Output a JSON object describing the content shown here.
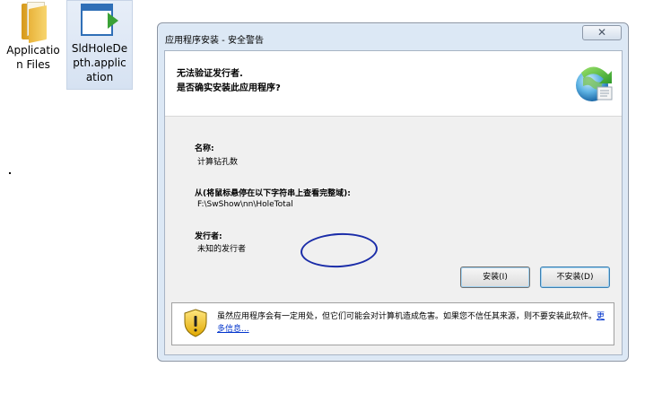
{
  "desktop": {
    "icons": [
      {
        "name": "folder",
        "label_line1": "Applicatio",
        "label_line2": "n Files"
      },
      {
        "name": "application",
        "label_line1": "SldHoleDe",
        "label_line2": "pth.applic",
        "label_line3": "ation"
      }
    ]
  },
  "dialog": {
    "title": "应用程序安装 - 安全警告",
    "close_glyph": "✕",
    "header": {
      "line1": "无法验证发行者.",
      "line2": "是否确实安装此应用程序?"
    },
    "info": {
      "name_label": "名称:",
      "name_value": "计算钻孔数",
      "from_label": "从(将鼠标悬停在以下字符串上查看完整域):",
      "from_value": "F:\\SwShow\\nn\\HoleTotal",
      "publisher_label": "发行者:",
      "publisher_value": "未知的发行者"
    },
    "buttons": {
      "install": "安装(I)",
      "no_install": "不安装(D)"
    },
    "warning": {
      "text": "虽然应用程序会有一定用处，但它们可能会对计算机造成危害。如果您不信任其来源，则不要安装此软件。",
      "link": "更多信息..."
    },
    "colors": {
      "link": "#0033cc",
      "annotation_circle": "#1a2ca8"
    }
  }
}
